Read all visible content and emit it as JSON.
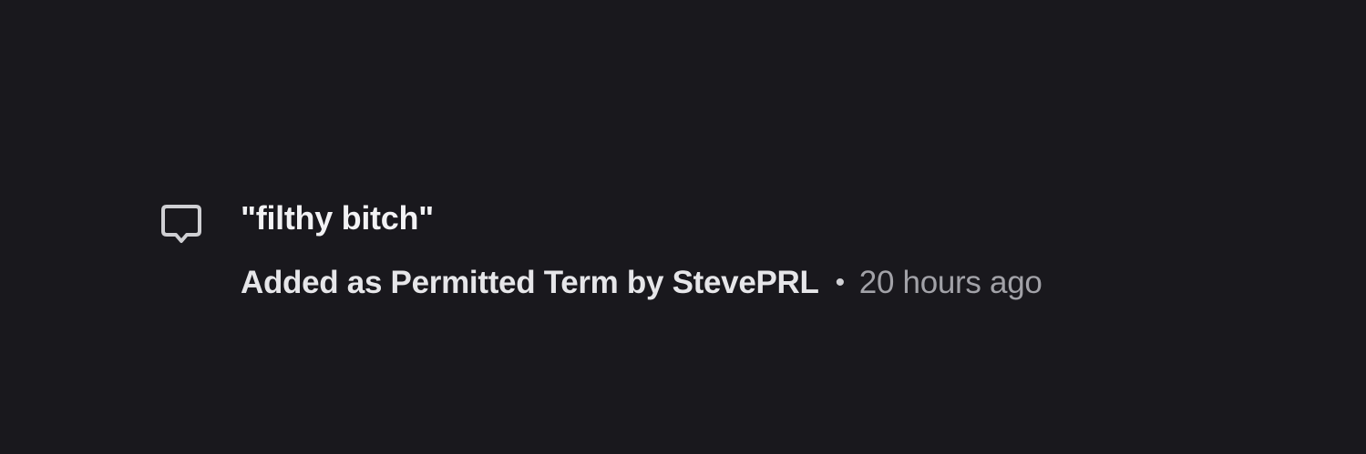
{
  "activity": {
    "icon": "comment-icon",
    "term": "\"filthy bitch\"",
    "action": "Added as Permitted Term by StevePRL",
    "separator": "•",
    "time": "20 hours ago",
    "colors": {
      "background": "#19181d",
      "primary_text": "#f2f2f4",
      "secondary_text": "#a2a2a8"
    }
  }
}
